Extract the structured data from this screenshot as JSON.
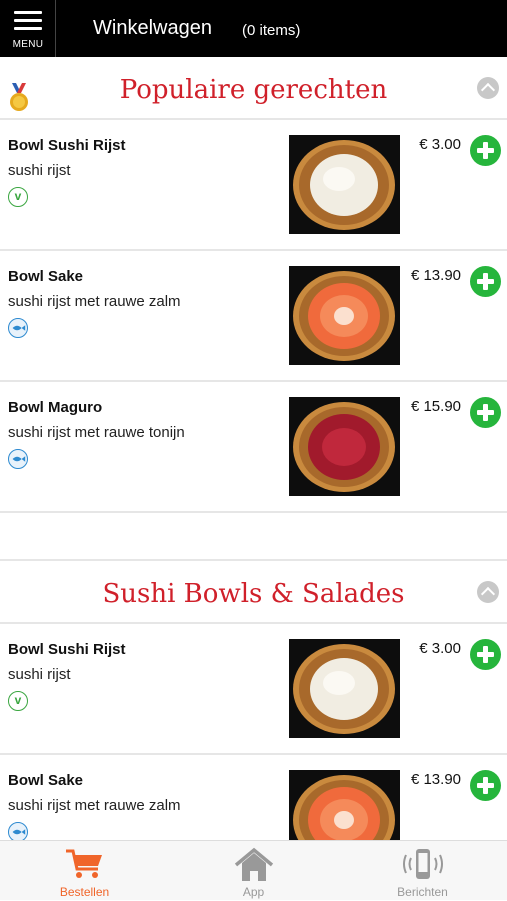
{
  "header": {
    "menu_label": "MENU",
    "cart_title": "Winkelwagen",
    "cart_count": "(0 items)"
  },
  "sections": [
    {
      "title": "Populaire gerechten",
      "items": [
        {
          "name": "Bowl Sushi Rijst",
          "description": "sushi rijst",
          "price": "€ 3.00",
          "diet": "vegetarian-icon",
          "image": "rice"
        },
        {
          "name": "Bowl Sake",
          "description": "sushi rijst met rauwe zalm",
          "price": "€ 13.90",
          "diet": "fish-icon",
          "image": "salmon"
        },
        {
          "name": "Bowl Maguro",
          "description": "sushi rijst met rauwe tonijn",
          "price": "€ 15.90",
          "diet": "fish-icon",
          "image": "tuna"
        }
      ]
    },
    {
      "title": "Sushi Bowls & Salades",
      "items": [
        {
          "name": "Bowl Sushi Rijst",
          "description": "sushi rijst",
          "price": "€ 3.00",
          "diet": "vegetarian-icon",
          "image": "rice"
        },
        {
          "name": "Bowl Sake",
          "description": "sushi rijst met rauwe zalm",
          "price": "€ 13.90",
          "diet": "fish-icon",
          "image": "salmon"
        }
      ]
    }
  ],
  "tabs": [
    {
      "label": "Bestellen",
      "icon": "cart-icon",
      "active": true
    },
    {
      "label": "App",
      "icon": "home-icon",
      "active": false
    },
    {
      "label": "Berichten",
      "icon": "phone-message-icon",
      "active": false
    }
  ],
  "colors": {
    "accent": "#d0202a",
    "add_button": "#26b53c",
    "active_tab": "#f0652a",
    "header_bg": "#000000"
  }
}
